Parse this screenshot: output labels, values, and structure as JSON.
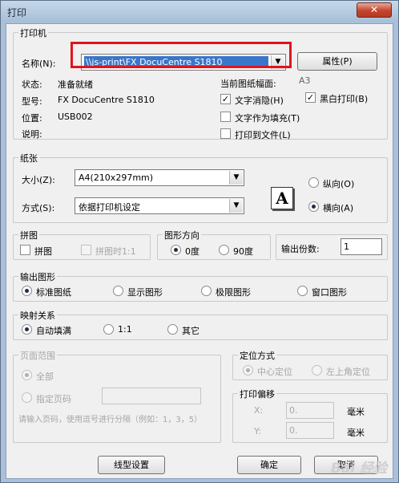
{
  "window": {
    "title": "打印",
    "close_glyph": "✕"
  },
  "printer": {
    "group_label": "打印机",
    "name_label": "名称(N):",
    "name_value": "\\\\js-print\\FX DocuCentre S1810",
    "properties_button": "属性(P)",
    "status_label": "状态:",
    "status_value": "准备就绪",
    "type_label": "型号:",
    "type_value": "FX DocuCentre S1810",
    "location_label": "位置:",
    "location_value": "USB002",
    "comment_label": "说明:",
    "paper_size_label": "当前图纸幅面:",
    "paper_size_value": "A3",
    "opt_hide_text": "文字消隐(H)",
    "opt_text_as_fill": "文字作为填充(T)",
    "opt_print_to_file": "打印到文件(L)",
    "opt_black_white": "黑白打印(B)",
    "checked": {
      "hide_text": true,
      "text_as_fill": false,
      "print_to_file": false,
      "black_white": true
    }
  },
  "paper": {
    "group_label": "纸张",
    "size_label": "大小(Z):",
    "size_value": "A4(210x297mm)",
    "mode_label": "方式(S):",
    "mode_value": "依据打印机设定",
    "portrait": "纵向(O)",
    "landscape": "横向(A)",
    "orientation_icon": "A",
    "selected": "landscape"
  },
  "tiling": {
    "group_label": "拼图",
    "opt_tile": "拼图",
    "opt_tile_overlap": "拼图时1:1"
  },
  "direction": {
    "group_label": "图形方向",
    "deg0": "0度",
    "deg90": "90度",
    "selected": "0"
  },
  "copies": {
    "label": "输出份数:",
    "value": "1"
  },
  "output": {
    "group_label": "输出图形",
    "opt_standard": "标准图纸",
    "opt_display": "显示图形",
    "opt_extents": "极限图形",
    "opt_window": "窗口图形",
    "selected": "standard"
  },
  "mapping": {
    "group_label": "映射关系",
    "opt_fit": "自动填满",
    "opt_1to1": "1:1",
    "opt_other": "其它",
    "selected": "fit"
  },
  "page_range": {
    "group_label": "页面范围",
    "opt_all": "全部",
    "opt_specified": "指定页码",
    "hint": "请输入页码，使用逗号进行分隔（例如：1，3，5）"
  },
  "position": {
    "group_label": "定位方式",
    "opt_center": "中心定位",
    "opt_top_left": "左上角定位"
  },
  "offset": {
    "group_label": "打印偏移",
    "x_label": "X:",
    "y_label": "Y:",
    "x_value": "0.",
    "y_value": "0.",
    "unit": "毫米"
  },
  "buttons": {
    "linetype": "线型设置",
    "ok": "确定",
    "cancel": "取消"
  },
  "watermark": "Bai 经验"
}
